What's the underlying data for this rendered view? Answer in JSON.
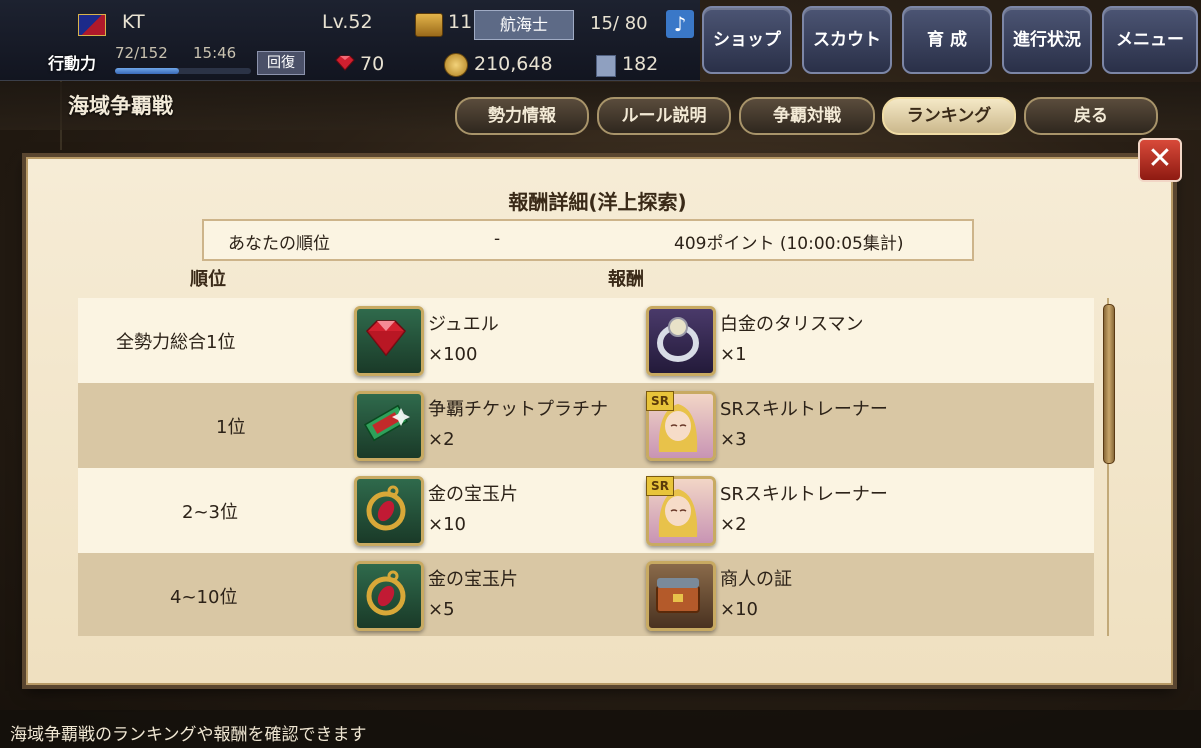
{
  "player": {
    "name": "KT",
    "level": "Lv.52",
    "chest_count": "11",
    "rank_badge": "航海士",
    "crew": "15/ 80",
    "action_label": "行動力",
    "action_value": "72/152",
    "action_fraction": 0.47,
    "action_time": "15:46",
    "recover_label": "回復",
    "jewels": "70",
    "gold": "210,648",
    "documents": "182"
  },
  "menu": {
    "shop": "ショップ",
    "scout": "スカウト",
    "train": "育 成",
    "progress": "進行状況",
    "main_menu": "メニュー"
  },
  "page": {
    "title": "海域争覇戦",
    "tabs": [
      "勢力情報",
      "ルール説明",
      "争覇対戦",
      "ランキング",
      "戻る"
    ]
  },
  "dialog": {
    "title": "報酬詳細(洋上探索)",
    "my_rank_label": "あなたの順位",
    "my_rank_value": "-",
    "my_points": "409ポイント (10:00:05集計)",
    "col_rank": "順位",
    "col_reward": "報酬",
    "rows": [
      {
        "rank": "全勢力総合1位",
        "reward1": {
          "icon": "jewel-icon",
          "name": "ジュエル",
          "qty": "×100"
        },
        "reward2": {
          "icon": "platinum-talisman-icon",
          "name": "白金のタリスマン",
          "qty": "×1"
        }
      },
      {
        "rank": "1位",
        "reward1": {
          "icon": "ticket-icon",
          "name": "争覇チケットプラチナ",
          "qty": "×2"
        },
        "reward2": {
          "icon": "sr-trainer-portrait-icon",
          "name": "SRスキルトレーナー",
          "qty": "×3"
        }
      },
      {
        "rank": "2~3位",
        "reward1": {
          "icon": "gold-gem-fragment-icon",
          "name": "金の宝玉片",
          "qty": "×10"
        },
        "reward2": {
          "icon": "sr-trainer-portrait-icon",
          "name": "SRスキルトレーナー",
          "qty": "×2"
        }
      },
      {
        "rank": "4~10位",
        "reward1": {
          "icon": "gold-gem-fragment-icon",
          "name": "金の宝玉片",
          "qty": "×5"
        },
        "reward2": {
          "icon": "merchant-proof-icon",
          "name": "商人の証",
          "qty": "×10"
        }
      }
    ],
    "sr_tag": "SR"
  },
  "footer": {
    "hint": "海域争覇戦のランキングや報酬を確認できます"
  },
  "colors": {
    "dialog_bg": "#f4e8cf",
    "row_alt": "#d9c7a4",
    "accent_red": "#c62a1e"
  }
}
